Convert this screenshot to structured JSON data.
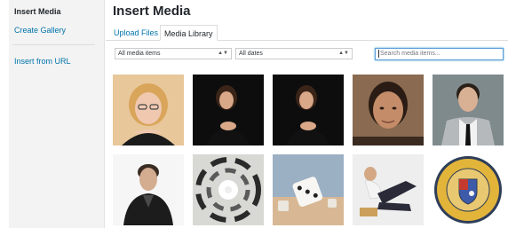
{
  "sidebar": {
    "title": "Insert Media",
    "items": [
      {
        "label": "Create Gallery"
      },
      {
        "label": "Insert from URL"
      }
    ]
  },
  "frame": {
    "title": "Insert Media"
  },
  "tabs": [
    {
      "label": "Upload Files",
      "active": false
    },
    {
      "label": "Media Library",
      "active": true
    }
  ],
  "filters": {
    "type": {
      "selected": "All media items"
    },
    "date": {
      "selected": "All dates"
    },
    "search": {
      "placeholder": "Search media items..."
    }
  },
  "media": [
    {
      "icon": "woman-red-hair-glasses-icon"
    },
    {
      "icon": "woman-black-sweater-icon"
    },
    {
      "icon": "woman-black-sweater-icon"
    },
    {
      "icon": "man-dark-hair-portrait-icon"
    },
    {
      "icon": "man-white-shirt-tie-icon"
    },
    {
      "icon": "man-leather-jacket-icon"
    },
    {
      "icon": "abstract-spiral-icon"
    },
    {
      "icon": "dice-icon"
    },
    {
      "icon": "man-lying-pose-icon"
    },
    {
      "icon": "university-seal-icon"
    }
  ],
  "colors": {
    "link": "#0073aa",
    "text": "#23282d",
    "sidebar_bg": "#f3f3f3",
    "focus": "#5b9dd9"
  }
}
